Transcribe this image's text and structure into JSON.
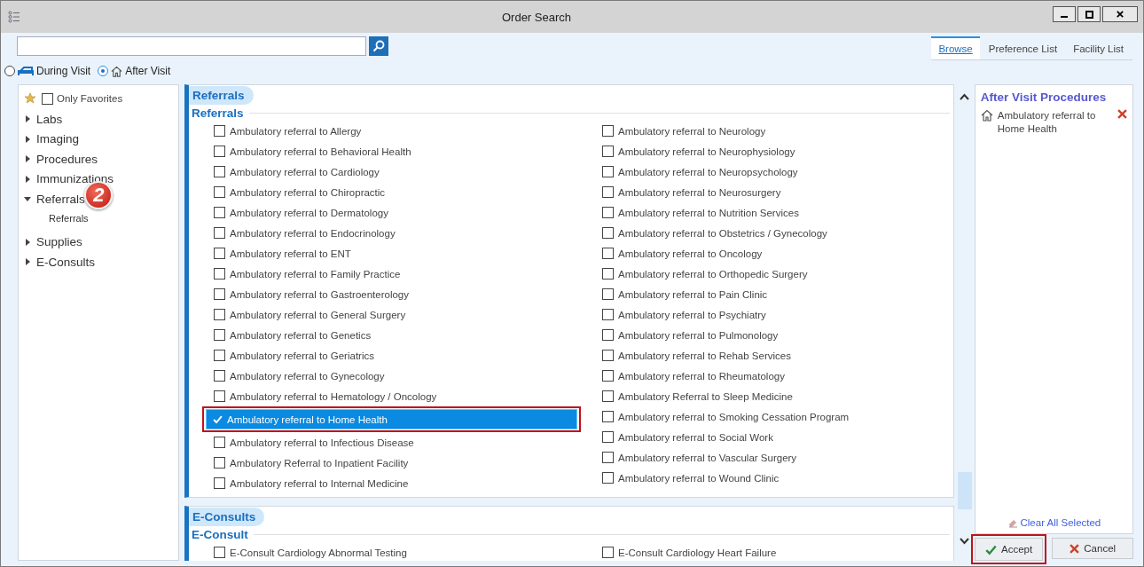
{
  "window": {
    "title": "Order Search"
  },
  "tabs": [
    {
      "label": "Browse",
      "selected": true
    },
    {
      "label": "Preference List",
      "selected": false
    },
    {
      "label": "Facility List",
      "selected": false
    }
  ],
  "visit_options": [
    {
      "label": "During Visit",
      "kind": "bed",
      "selected": false
    },
    {
      "label": "After Visit",
      "kind": "home",
      "selected": true
    }
  ],
  "sidebar": {
    "favorites": {
      "label": "Only Favorites",
      "checked": false
    },
    "items": [
      {
        "label": "Labs",
        "expanded": false
      },
      {
        "label": "Imaging",
        "expanded": false
      },
      {
        "label": "Procedures",
        "expanded": false
      },
      {
        "label": "Immunizations",
        "expanded": false
      },
      {
        "label": "Referrals",
        "expanded": true,
        "badge": "2",
        "children": [
          {
            "label": "Referrals"
          }
        ]
      },
      {
        "label": "Supplies",
        "expanded": false
      },
      {
        "label": "E-Consults",
        "expanded": false
      }
    ]
  },
  "sections": [
    {
      "title": "Referrals",
      "groups": [
        {
          "title": "Referrals",
          "columns": [
            {
              "items": [
                {
                  "label": "Ambulatory referral to Allergy",
                  "checked": false,
                  "highlighted": false
                },
                {
                  "label": "Ambulatory referral to Behavioral Health",
                  "checked": false,
                  "highlighted": false
                },
                {
                  "label": "Ambulatory referral to Cardiology",
                  "checked": false,
                  "highlighted": false
                },
                {
                  "label": "Ambulatory referral to Chiropractic",
                  "checked": false,
                  "highlighted": false
                },
                {
                  "label": "Ambulatory referral to Dermatology",
                  "checked": false,
                  "highlighted": false
                },
                {
                  "label": "Ambulatory referral to Endocrinology",
                  "checked": false,
                  "highlighted": false
                },
                {
                  "label": "Ambulatory referral to ENT",
                  "checked": false,
                  "highlighted": false
                },
                {
                  "label": "Ambulatory referral to Family Practice",
                  "checked": false,
                  "highlighted": false
                },
                {
                  "label": "Ambulatory referral to Gastroenterology",
                  "checked": false,
                  "highlighted": false
                },
                {
                  "label": "Ambulatory referral to General Surgery",
                  "checked": false,
                  "highlighted": false
                },
                {
                  "label": "Ambulatory referral to Genetics",
                  "checked": false,
                  "highlighted": false
                },
                {
                  "label": "Ambulatory referral to Geriatrics",
                  "checked": false,
                  "highlighted": false
                },
                {
                  "label": "Ambulatory referral to Gynecology",
                  "checked": false,
                  "highlighted": false
                },
                {
                  "label": "Ambulatory referral to Hematology / Oncology",
                  "checked": false,
                  "highlighted": false
                },
                {
                  "label": "Ambulatory referral to Home Health",
                  "checked": true,
                  "highlighted": true
                },
                {
                  "label": "Ambulatory referral to Infectious Disease",
                  "checked": false,
                  "highlighted": false
                },
                {
                  "label": "Ambulatory Referral to Inpatient Facility",
                  "checked": false,
                  "highlighted": false
                },
                {
                  "label": "Ambulatory referral to Internal Medicine",
                  "checked": false,
                  "highlighted": false
                }
              ]
            },
            {
              "items": [
                {
                  "label": "Ambulatory referral to Neurology",
                  "checked": false,
                  "highlighted": false
                },
                {
                  "label": "Ambulatory referral to Neurophysiology",
                  "checked": false,
                  "highlighted": false
                },
                {
                  "label": "Ambulatory referral to Neuropsychology",
                  "checked": false,
                  "highlighted": false
                },
                {
                  "label": "Ambulatory referral to Neurosurgery",
                  "checked": false,
                  "highlighted": false
                },
                {
                  "label": "Ambulatory referral to Nutrition Services",
                  "checked": false,
                  "highlighted": false
                },
                {
                  "label": "Ambulatory referral to Obstetrics / Gynecology",
                  "checked": false,
                  "highlighted": false
                },
                {
                  "label": "Ambulatory referral to Oncology",
                  "checked": false,
                  "highlighted": false
                },
                {
                  "label": "Ambulatory referral to Orthopedic Surgery",
                  "checked": false,
                  "highlighted": false
                },
                {
                  "label": "Ambulatory referral to Pain Clinic",
                  "checked": false,
                  "highlighted": false
                },
                {
                  "label": "Ambulatory referral to Psychiatry",
                  "checked": false,
                  "highlighted": false
                },
                {
                  "label": "Ambulatory referral to Pulmonology",
                  "checked": false,
                  "highlighted": false
                },
                {
                  "label": "Ambulatory referral to Rehab Services",
                  "checked": false,
                  "highlighted": false
                },
                {
                  "label": "Ambulatory referral to Rheumatology",
                  "checked": false,
                  "highlighted": false
                },
                {
                  "label": "Ambulatory Referral to Sleep Medicine",
                  "checked": false,
                  "highlighted": false
                },
                {
                  "label": "Ambulatory referral to Smoking Cessation Program",
                  "checked": false,
                  "highlighted": false
                },
                {
                  "label": "Ambulatory referral to Social Work",
                  "checked": false,
                  "highlighted": false
                },
                {
                  "label": "Ambulatory referral to Vascular Surgery",
                  "checked": false,
                  "highlighted": false
                },
                {
                  "label": "Ambulatory referral to Wound Clinic",
                  "checked": false,
                  "highlighted": false
                }
              ]
            }
          ]
        }
      ]
    },
    {
      "title": "E-Consults",
      "groups": [
        {
          "title": "E-Consult",
          "columns": [
            {
              "items": [
                {
                  "label": "E-Consult Cardiology Abnormal Testing",
                  "checked": false,
                  "highlighted": false
                }
              ]
            },
            {
              "items": [
                {
                  "label": "E-Consult Cardiology Heart Failure",
                  "checked": false,
                  "highlighted": false
                }
              ]
            }
          ]
        }
      ]
    }
  ],
  "selected_panel": {
    "title": "After Visit Procedures",
    "items": [
      {
        "label": "Ambulatory referral to Home Health"
      }
    ],
    "clear_link": "Clear All Selected"
  },
  "buttons": [
    {
      "label": "Accept",
      "kind": "accept",
      "highlighted": true
    },
    {
      "label": "Cancel",
      "kind": "cancel",
      "highlighted": false
    }
  ]
}
